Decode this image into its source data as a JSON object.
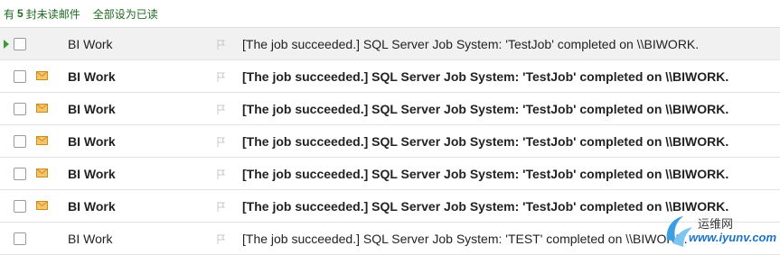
{
  "toolbar": {
    "prefix": "有",
    "unread_count": "5",
    "suffix": "封未读邮件",
    "mark_all_read": "全部设为已读"
  },
  "rows": [
    {
      "sender": "BI Work",
      "subject": "[The job succeeded.] SQL Server Job System: 'TestJob' completed on \\\\BIWORK.",
      "unread": false,
      "selected": true
    },
    {
      "sender": "BI Work",
      "subject": "[The job succeeded.] SQL Server Job System: 'TestJob' completed on \\\\BIWORK.",
      "unread": true,
      "selected": false
    },
    {
      "sender": "BI Work",
      "subject": "[The job succeeded.] SQL Server Job System: 'TestJob' completed on \\\\BIWORK.",
      "unread": true,
      "selected": false
    },
    {
      "sender": "BI Work",
      "subject": "[The job succeeded.] SQL Server Job System: 'TestJob' completed on \\\\BIWORK.",
      "unread": true,
      "selected": false
    },
    {
      "sender": "BI Work",
      "subject": "[The job succeeded.] SQL Server Job System: 'TestJob' completed on \\\\BIWORK.",
      "unread": true,
      "selected": false
    },
    {
      "sender": "BI Work",
      "subject": "[The job succeeded.] SQL Server Job System: 'TestJob' completed on \\\\BIWORK.",
      "unread": true,
      "selected": false
    },
    {
      "sender": "BI Work",
      "subject": "[The job succeeded.] SQL Server Job System: 'TEST' completed on \\\\BIWORK.",
      "unread": false,
      "selected": false
    }
  ],
  "watermark": {
    "line1": "运维网",
    "line2": "www.iyunv.com"
  },
  "colors": {
    "accent_green": "#1f6a1f",
    "envelope": "#e8a33a",
    "selected_bg": "#f1f1f1"
  }
}
